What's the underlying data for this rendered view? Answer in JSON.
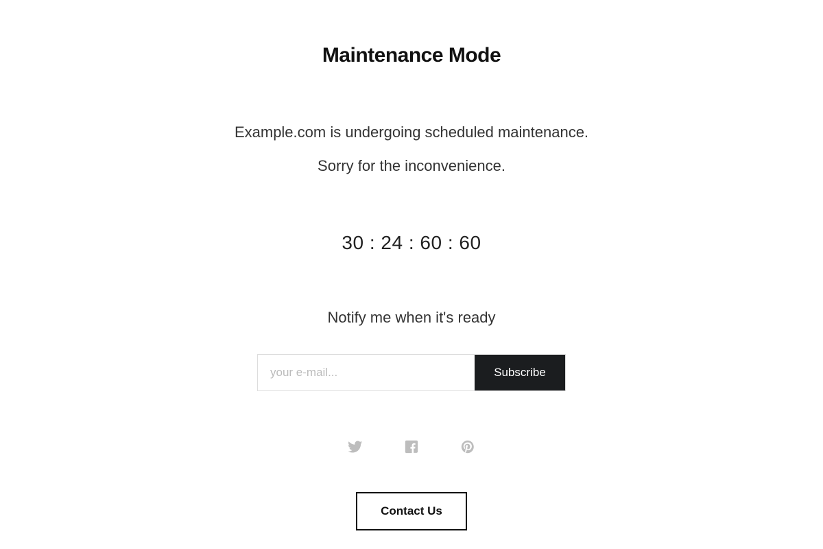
{
  "heading": "Maintenance Mode",
  "message_line1": "Example.com is undergoing scheduled maintenance.",
  "message_line2": "Sorry for the inconvenience.",
  "countdown": {
    "days": "30",
    "hours": "24",
    "minutes": "60",
    "seconds": "60",
    "sep": " : "
  },
  "notify": {
    "label": "Notify me when it's ready",
    "placeholder": "your e-mail...",
    "button": "Subscribe"
  },
  "social": {
    "twitter": "twitter",
    "facebook": "facebook",
    "pinterest": "pinterest"
  },
  "contact_button": "Contact Us"
}
